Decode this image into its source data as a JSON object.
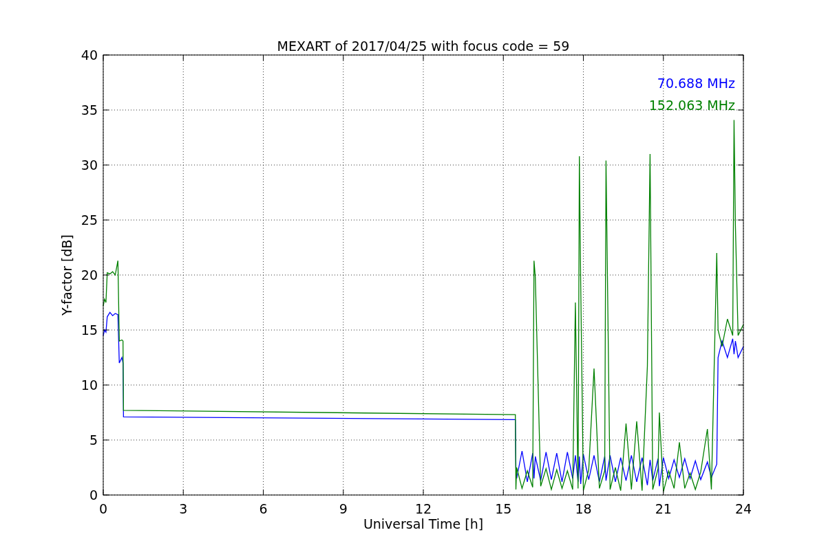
{
  "figure": {
    "chart_data": {
      "type": "line",
      "title": "MEXART of 2017/04/25 with focus code = 59",
      "xlabel": "Universal Time [h]",
      "ylabel": "Y-factor [dB]",
      "x": [
        0,
        0.05,
        0.1,
        0.15,
        0.25,
        0.35,
        0.45,
        0.55,
        0.6,
        0.7,
        0.74,
        0.76,
        15.45,
        15.47,
        15.5,
        15.7,
        15.9,
        16.1,
        16.15,
        16.2,
        16.4,
        16.6,
        16.8,
        17.0,
        17.2,
        17.4,
        17.6,
        17.7,
        17.8,
        17.85,
        17.9,
        18.0,
        18.2,
        18.4,
        18.6,
        18.8,
        18.85,
        19.0,
        19.2,
        19.4,
        19.6,
        19.8,
        20.0,
        20.2,
        20.4,
        20.5,
        20.6,
        20.8,
        20.85,
        21.0,
        21.2,
        21.4,
        21.6,
        21.8,
        22.0,
        22.2,
        22.4,
        22.65,
        22.8,
        23.0,
        23.05,
        23.2,
        23.4,
        23.6,
        23.65,
        23.7,
        23.8,
        24.0
      ],
      "series": [
        {
          "name": "70.688 MHz",
          "color": "#0000ff",
          "values": [
            14.5,
            15,
            14.8,
            16.2,
            16.6,
            16.3,
            16.5,
            16.4,
            12,
            12.5,
            12,
            7.1,
            6.85,
            2.5,
            1.5,
            4.0,
            1.2,
            3.8,
            1.5,
            3.5,
            1.3,
            3.9,
            1.4,
            3.8,
            1.2,
            3.9,
            1.5,
            3.6,
            1.2,
            3.5,
            1.0,
            3.7,
            1.4,
            3.6,
            1.2,
            3.5,
            1.3,
            3.6,
            1.2,
            3.4,
            1.3,
            3.6,
            1.2,
            3.4,
            0.9,
            3.2,
            1.3,
            3.3,
            0.8,
            3.4,
            1.5,
            3.2,
            1.6,
            3.3,
            1.5,
            3.1,
            1.4,
            3.0,
            1.6,
            2.8,
            12.5,
            14,
            12.5,
            14.2,
            12.8,
            14,
            12.5,
            13.5
          ]
        },
        {
          "name": "152.063 MHz",
          "color": "#008000",
          "values": [
            17.2,
            17.8,
            17.5,
            20.2,
            20.1,
            20.3,
            20.0,
            21.3,
            14,
            14.1,
            14,
            7.7,
            7.3,
            0.5,
            2.5,
            0.6,
            2.2,
            0.7,
            21.3,
            19.8,
            0.8,
            2.4,
            0.5,
            2.3,
            0.6,
            2.2,
            0.5,
            17.5,
            0.6,
            30.8,
            19.5,
            0.4,
            2.3,
            11.5,
            0.6,
            2.2,
            30.4,
            0.5,
            2.5,
            0.4,
            6.5,
            0.5,
            6.7,
            0.4,
            11.7,
            31,
            0.5,
            2.4,
            7.5,
            0.3,
            2.2,
            0.6,
            4.8,
            0.6,
            2.0,
            0.5,
            2.1,
            6.0,
            0.5,
            22,
            15,
            13.5,
            16,
            14.5,
            34.1,
            24.5,
            14.5,
            15.5
          ]
        }
      ],
      "grid": true,
      "xlim": [
        0,
        24
      ],
      "ylim": [
        0,
        40
      ],
      "xticks": [
        0,
        3,
        6,
        9,
        12,
        15,
        18,
        21,
        24
      ],
      "yticks": [
        0,
        5,
        10,
        15,
        20,
        25,
        30,
        35,
        40
      ]
    }
  }
}
